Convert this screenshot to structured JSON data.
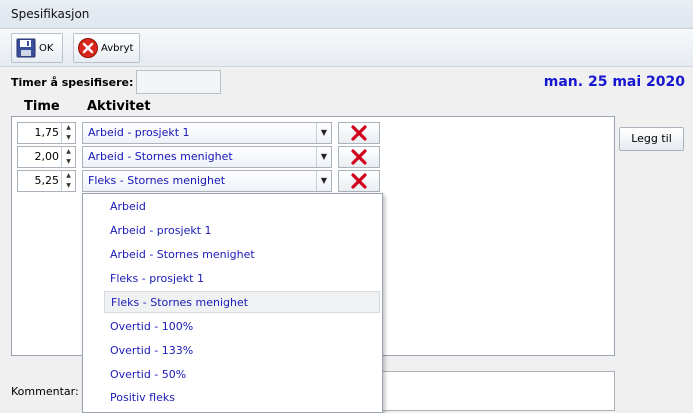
{
  "window": {
    "title": "Spesifikasjon"
  },
  "toolbar": {
    "ok_label": "OK",
    "cancel_label": "Avbryt"
  },
  "form": {
    "timer_label": "Timer å spesifisere:",
    "timer_value": "",
    "date": "man. 25 mai 2020",
    "col_time": "Time",
    "col_activity": "Aktivitet"
  },
  "rows": [
    {
      "hours": "1,75",
      "activity": "Arbeid - prosjekt 1"
    },
    {
      "hours": "2,00",
      "activity": "Arbeid - Stornes menighet"
    },
    {
      "hours": "5,25",
      "activity": "Fleks - Stornes menighet"
    }
  ],
  "add_label": "Legg til",
  "comment_label": "Kommentar:",
  "dropdown": {
    "selected_index": 4,
    "options": [
      "Arbeid",
      "Arbeid - prosjekt 1",
      "Arbeid - Stornes menighet",
      "Fleks - prosjekt 1",
      "Fleks - Stornes menighet",
      "Overtid - 100%",
      "Overtid - 133%",
      "Overtid - 50%",
      "Positiv fleks"
    ]
  },
  "colors": {
    "accent_text": "#1717d0",
    "delete_red": "#d0021b"
  },
  "icons": {
    "ok": "floppy-disk-icon",
    "cancel": "red-circle-x-icon",
    "delete": "red-x-icon"
  }
}
